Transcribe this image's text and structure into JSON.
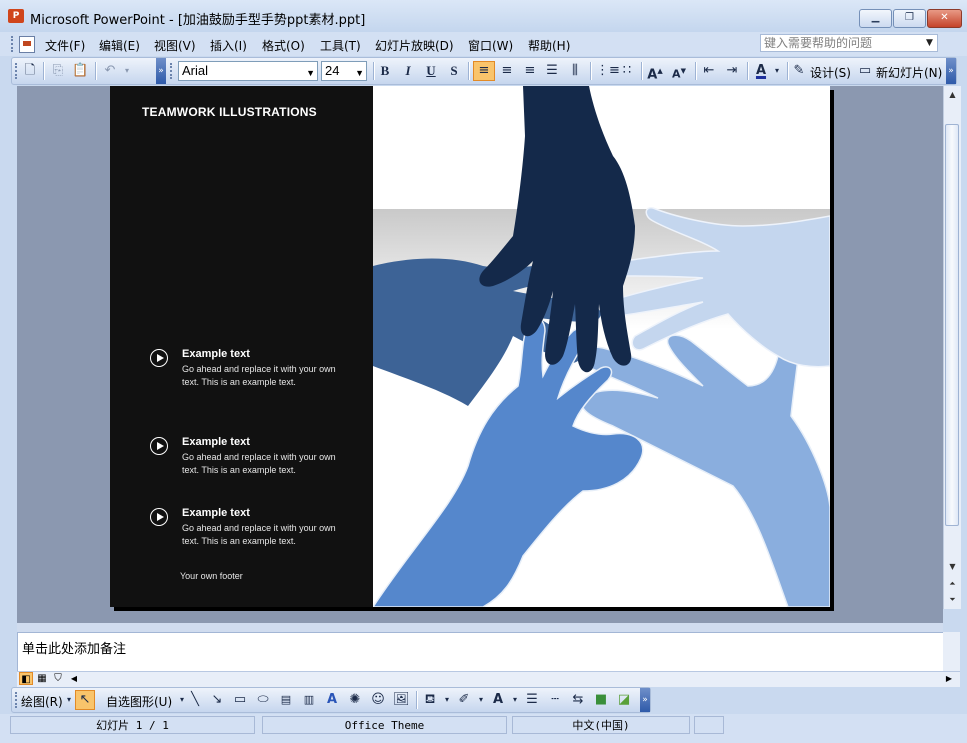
{
  "window": {
    "title": "Microsoft PowerPoint - [加油鼓励手型手势ppt素材.ppt]",
    "controls": [
      "minimize",
      "restore",
      "close"
    ]
  },
  "menubar": {
    "items": [
      "文件(F)",
      "编辑(E)",
      "视图(V)",
      "插入(I)",
      "格式(O)",
      "工具(T)",
      "幻灯片放映(D)",
      "窗口(W)",
      "帮助(H)"
    ],
    "help_placeholder": "键入需要帮助的问题"
  },
  "toolbar": {
    "font_name": "Arial",
    "font_size": "24",
    "design_label": "设计(S)",
    "new_slide_label": "新幻灯片(N)"
  },
  "slide": {
    "title": "TEAMWORK ILLUSTRATIONS",
    "bullets": [
      {
        "heading": "Example text",
        "body": "Go ahead and replace it with your own text. This is an example text."
      },
      {
        "heading": "Example text",
        "body": "Go ahead and replace it with your own text. This is an example text."
      },
      {
        "heading": "Example text",
        "body": "Go ahead and replace it with your own text. This is an example text."
      }
    ],
    "footer": "Your own footer",
    "colors": {
      "left_panel": "#111111",
      "hand_navy": "#14294a",
      "hand_steel": "#3d6396",
      "hand_blue": "#5587cc",
      "hand_light": "#c4d6ee",
      "hand_mid": "#8aaede"
    }
  },
  "notes": {
    "placeholder": "单击此处添加备注"
  },
  "drawing_toolbar": {
    "draw_label": "绘图(R)",
    "autoshapes_label": "自选图形(U)"
  },
  "statusbar": {
    "slide_info": "幻灯片 1 / 1",
    "theme": "Office Theme",
    "language": "中文(中国)"
  }
}
